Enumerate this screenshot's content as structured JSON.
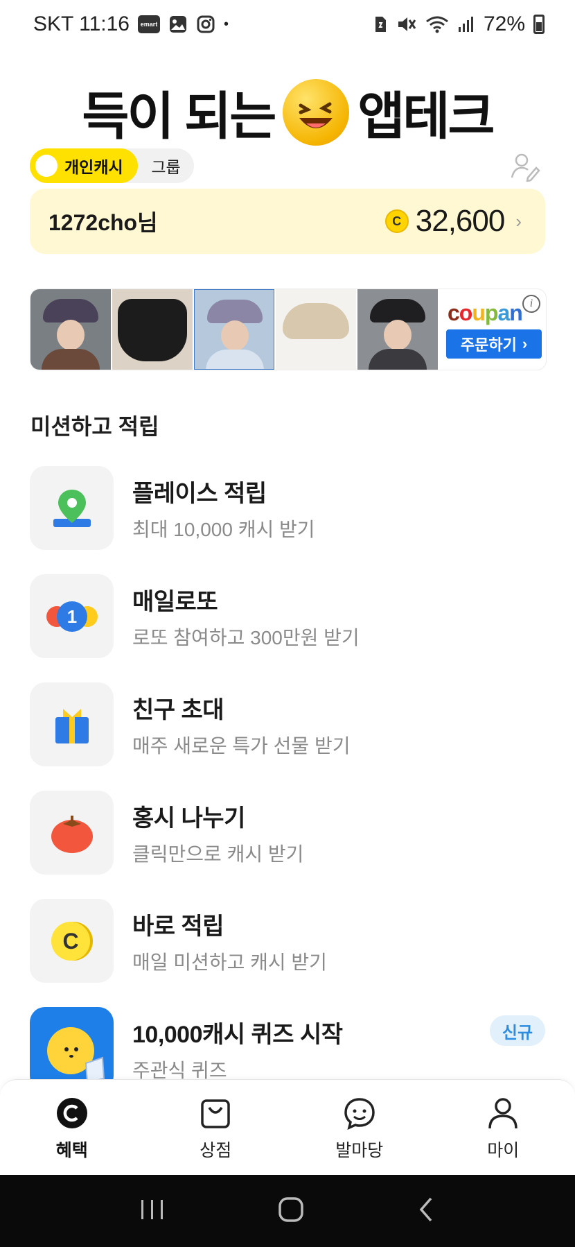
{
  "status_bar": {
    "carrier_time": "SKT 11:16",
    "emart_label": "emart",
    "battery": "72%"
  },
  "header": {
    "title_left": "득이 되는",
    "title_right": "앱테크"
  },
  "segment": {
    "personal_label": "개인캐시",
    "group_label": "그룹"
  },
  "cash_card": {
    "user_name": "1272cho님",
    "coin_symbol": "C",
    "balance": "32,600",
    "chevron": "›"
  },
  "ad": {
    "brand": [
      "c",
      "o",
      "u",
      "p",
      "a",
      "n"
    ],
    "order_label": "주문하기",
    "order_arrow": "›",
    "info_symbol": "i"
  },
  "section": {
    "title": "미션하고 적립"
  },
  "missions": [
    {
      "title": "플레이스 적립",
      "subtitle": "최대 10,000 캐시 받기",
      "icon": "map-pin-icon"
    },
    {
      "title": "매일로또",
      "subtitle": "로또 참여하고 300만원 받기",
      "icon": "lotto-ball-icon",
      "ball_number": "1"
    },
    {
      "title": "친구 초대",
      "subtitle": "매주 새로운 특가 선물 받기",
      "icon": "gift-icon"
    },
    {
      "title": "홍시 나누기",
      "subtitle": "클릭만으로 캐시 받기",
      "icon": "persimmon-icon"
    },
    {
      "title": "바로 적립",
      "subtitle": "매일 미션하고 캐시 받기",
      "icon": "coin-icon",
      "coin_symbol": "C"
    },
    {
      "title": "10,000캐시 퀴즈 시작",
      "subtitle": "주관식 퀴즈",
      "icon": "quiz-icon",
      "badge": "신규"
    }
  ],
  "bottom_nav": [
    {
      "label": "혜택",
      "icon": "cash-coin-icon",
      "active": true
    },
    {
      "label": "상점",
      "icon": "shopping-bag-icon",
      "active": false
    },
    {
      "label": "발마당",
      "icon": "smile-chat-icon",
      "active": false
    },
    {
      "label": "마이",
      "icon": "person-icon",
      "active": false
    }
  ],
  "colors": {
    "accent_yellow": "#ffe100",
    "card_bg": "#fff8d2",
    "badge_blue": "#2d8cdf",
    "coupang_btn": "#1b73e8"
  }
}
